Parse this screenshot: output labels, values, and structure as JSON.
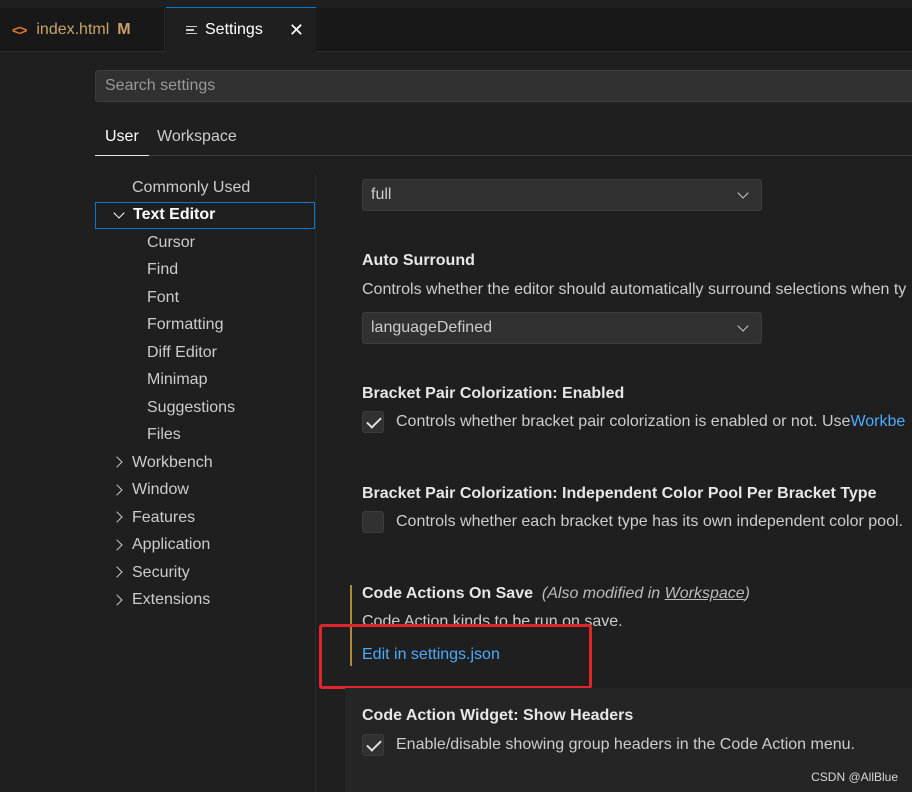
{
  "tabs": [
    {
      "label": "index.html",
      "badge": "M",
      "icon": "code-icon"
    },
    {
      "label": "Settings",
      "icon": "settings-lines-icon",
      "close": "✕"
    }
  ],
  "search": {
    "placeholder": "Search settings"
  },
  "scope_tabs": [
    "User",
    "Workspace"
  ],
  "tree": {
    "commonly_used": "Commonly Used",
    "text_editor": "Text Editor",
    "text_editor_children": [
      "Cursor",
      "Find",
      "Font",
      "Formatting",
      "Diff Editor",
      "Minimap",
      "Suggestions",
      "Files"
    ],
    "groups": [
      "Workbench",
      "Window",
      "Features",
      "Application",
      "Security",
      "Extensions"
    ]
  },
  "settings": {
    "top_select": "full",
    "auto_surround": {
      "title": "Auto Surround",
      "desc": "Controls whether the editor should automatically surround selections when ty",
      "value": "languageDefined"
    },
    "bracket_enabled": {
      "prefix": "Bracket Pair Colorization: ",
      "name": "Enabled",
      "desc": "Controls whether bracket pair colorization is enabled or not. Use ",
      "link": "Workbe",
      "checked": true
    },
    "bracket_pool": {
      "prefix": "Bracket Pair Colorization: ",
      "name": "Independent Color Pool Per Bracket Type",
      "desc": "Controls whether each bracket type has its own independent color pool.",
      "checked": false
    },
    "code_actions_on_save": {
      "title": "Code Actions On Save",
      "modified_prefix": "(Also modified in ",
      "modified_link": "Workspace",
      "modified_suffix": ")",
      "desc": "Code Action kinds to be run on save.",
      "edit_link": "Edit in settings.json"
    },
    "code_action_widget": {
      "prefix": "Code Action Widget: ",
      "name": "Show Headers",
      "desc": "Enable/disable showing group headers in the Code Action menu.",
      "checked": true
    }
  },
  "watermark": "CSDN @AllBlue",
  "colors": {
    "accent": "#0078d4",
    "link": "#4daafc",
    "highlight_box": "#e0262a",
    "modified_bar": "#ac8a3b"
  }
}
